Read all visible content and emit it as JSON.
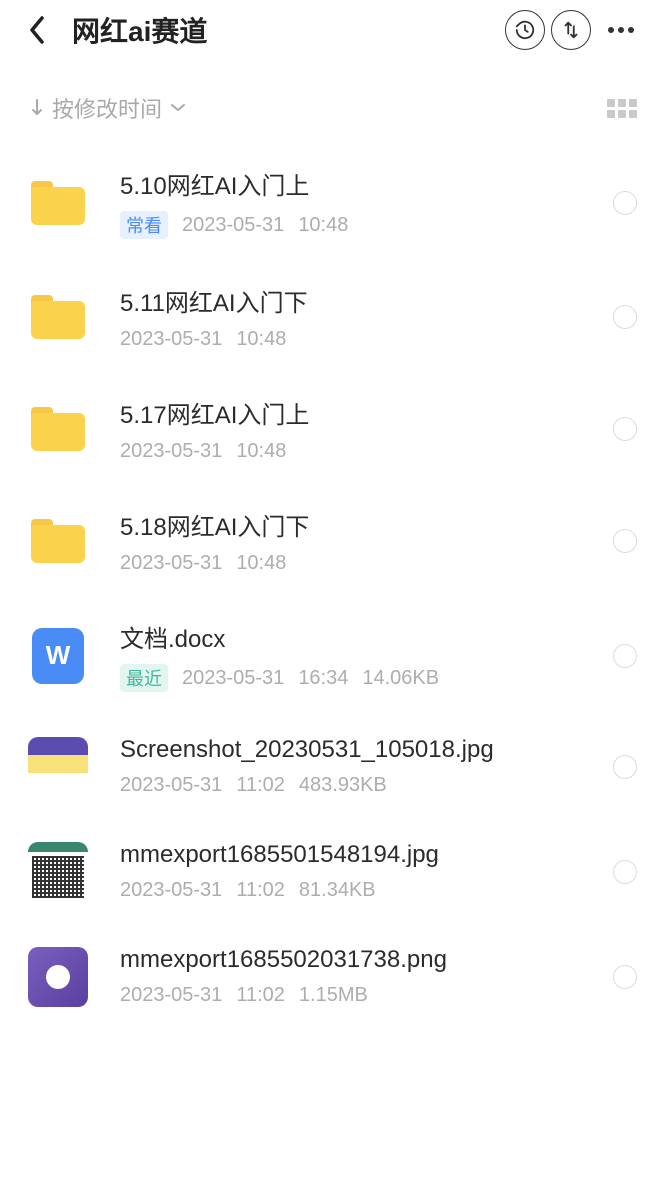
{
  "header": {
    "title": "网红ai赛道"
  },
  "sort": {
    "label": "按修改时间"
  },
  "items": [
    {
      "type": "folder",
      "name": "5.10网红AI入门上",
      "badge": "常看",
      "badgeStyle": "blue",
      "date": "2023-05-31",
      "time": "10:48",
      "size": ""
    },
    {
      "type": "folder",
      "name": "5.11网红AI入门下",
      "badge": "",
      "badgeStyle": "",
      "date": "2023-05-31",
      "time": "10:48",
      "size": ""
    },
    {
      "type": "folder",
      "name": "5.17网红AI入门上",
      "badge": "",
      "badgeStyle": "",
      "date": "2023-05-31",
      "time": "10:48",
      "size": ""
    },
    {
      "type": "folder",
      "name": "5.18网红AI入门下",
      "badge": "",
      "badgeStyle": "",
      "date": "2023-05-31",
      "time": "10:48",
      "size": ""
    },
    {
      "type": "docx",
      "name": "文档.docx",
      "badge": "最近",
      "badgeStyle": "teal",
      "date": "2023-05-31",
      "time": "16:34",
      "size": "14.06KB"
    },
    {
      "type": "img1",
      "name": "Screenshot_20230531_105018.jpg",
      "badge": "",
      "badgeStyle": "",
      "date": "2023-05-31",
      "time": "11:02",
      "size": "483.93KB"
    },
    {
      "type": "img2",
      "name": "mmexport1685501548194.jpg",
      "badge": "",
      "badgeStyle": "",
      "date": "2023-05-31",
      "time": "11:02",
      "size": "81.34KB"
    },
    {
      "type": "img3",
      "name": "mmexport1685502031738.png",
      "badge": "",
      "badgeStyle": "",
      "date": "2023-05-31",
      "time": "11:02",
      "size": "1.15MB"
    }
  ]
}
